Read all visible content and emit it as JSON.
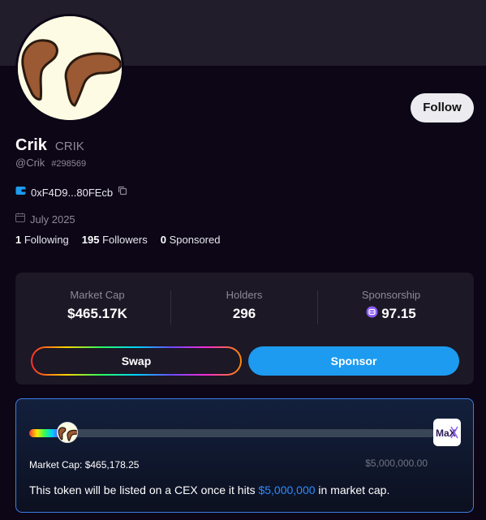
{
  "profile": {
    "name": "Crik",
    "ticker": "CRIK",
    "handle": "@Crik",
    "id": "#298569",
    "wallet": "0xF4D9...80FEcb",
    "joined": "July 2025",
    "follow_label": "Follow"
  },
  "social": {
    "following_count": "1",
    "following_label": "Following",
    "followers_count": "195",
    "followers_label": "Followers",
    "sponsored_count": "0",
    "sponsored_label": "Sponsored"
  },
  "metrics": {
    "market_cap_label": "Market Cap",
    "market_cap_value": "$465.17K",
    "holders_label": "Holders",
    "holders_value": "296",
    "sponsorship_label": "Sponsorship",
    "sponsorship_value": "97.15"
  },
  "actions": {
    "swap_label": "Swap",
    "sponsor_label": "Sponsor"
  },
  "progress": {
    "fraction": 0.093,
    "current_label": "Market Cap: $465,178.25",
    "target_label": "$5,000,000.00",
    "logo_text": "MaX",
    "note_prefix": "This token will be listed on a CEX once it hits ",
    "note_highlight": "$5,000,000",
    "note_suffix": " in market cap."
  },
  "colors": {
    "accent": "#1d9bf0",
    "highlight": "#2d8cff",
    "background": "#0c0617",
    "card": "#1c1826"
  },
  "icons": [
    "wallet-icon",
    "copy-icon",
    "calendar-icon",
    "sponsorship-coin-icon"
  ]
}
